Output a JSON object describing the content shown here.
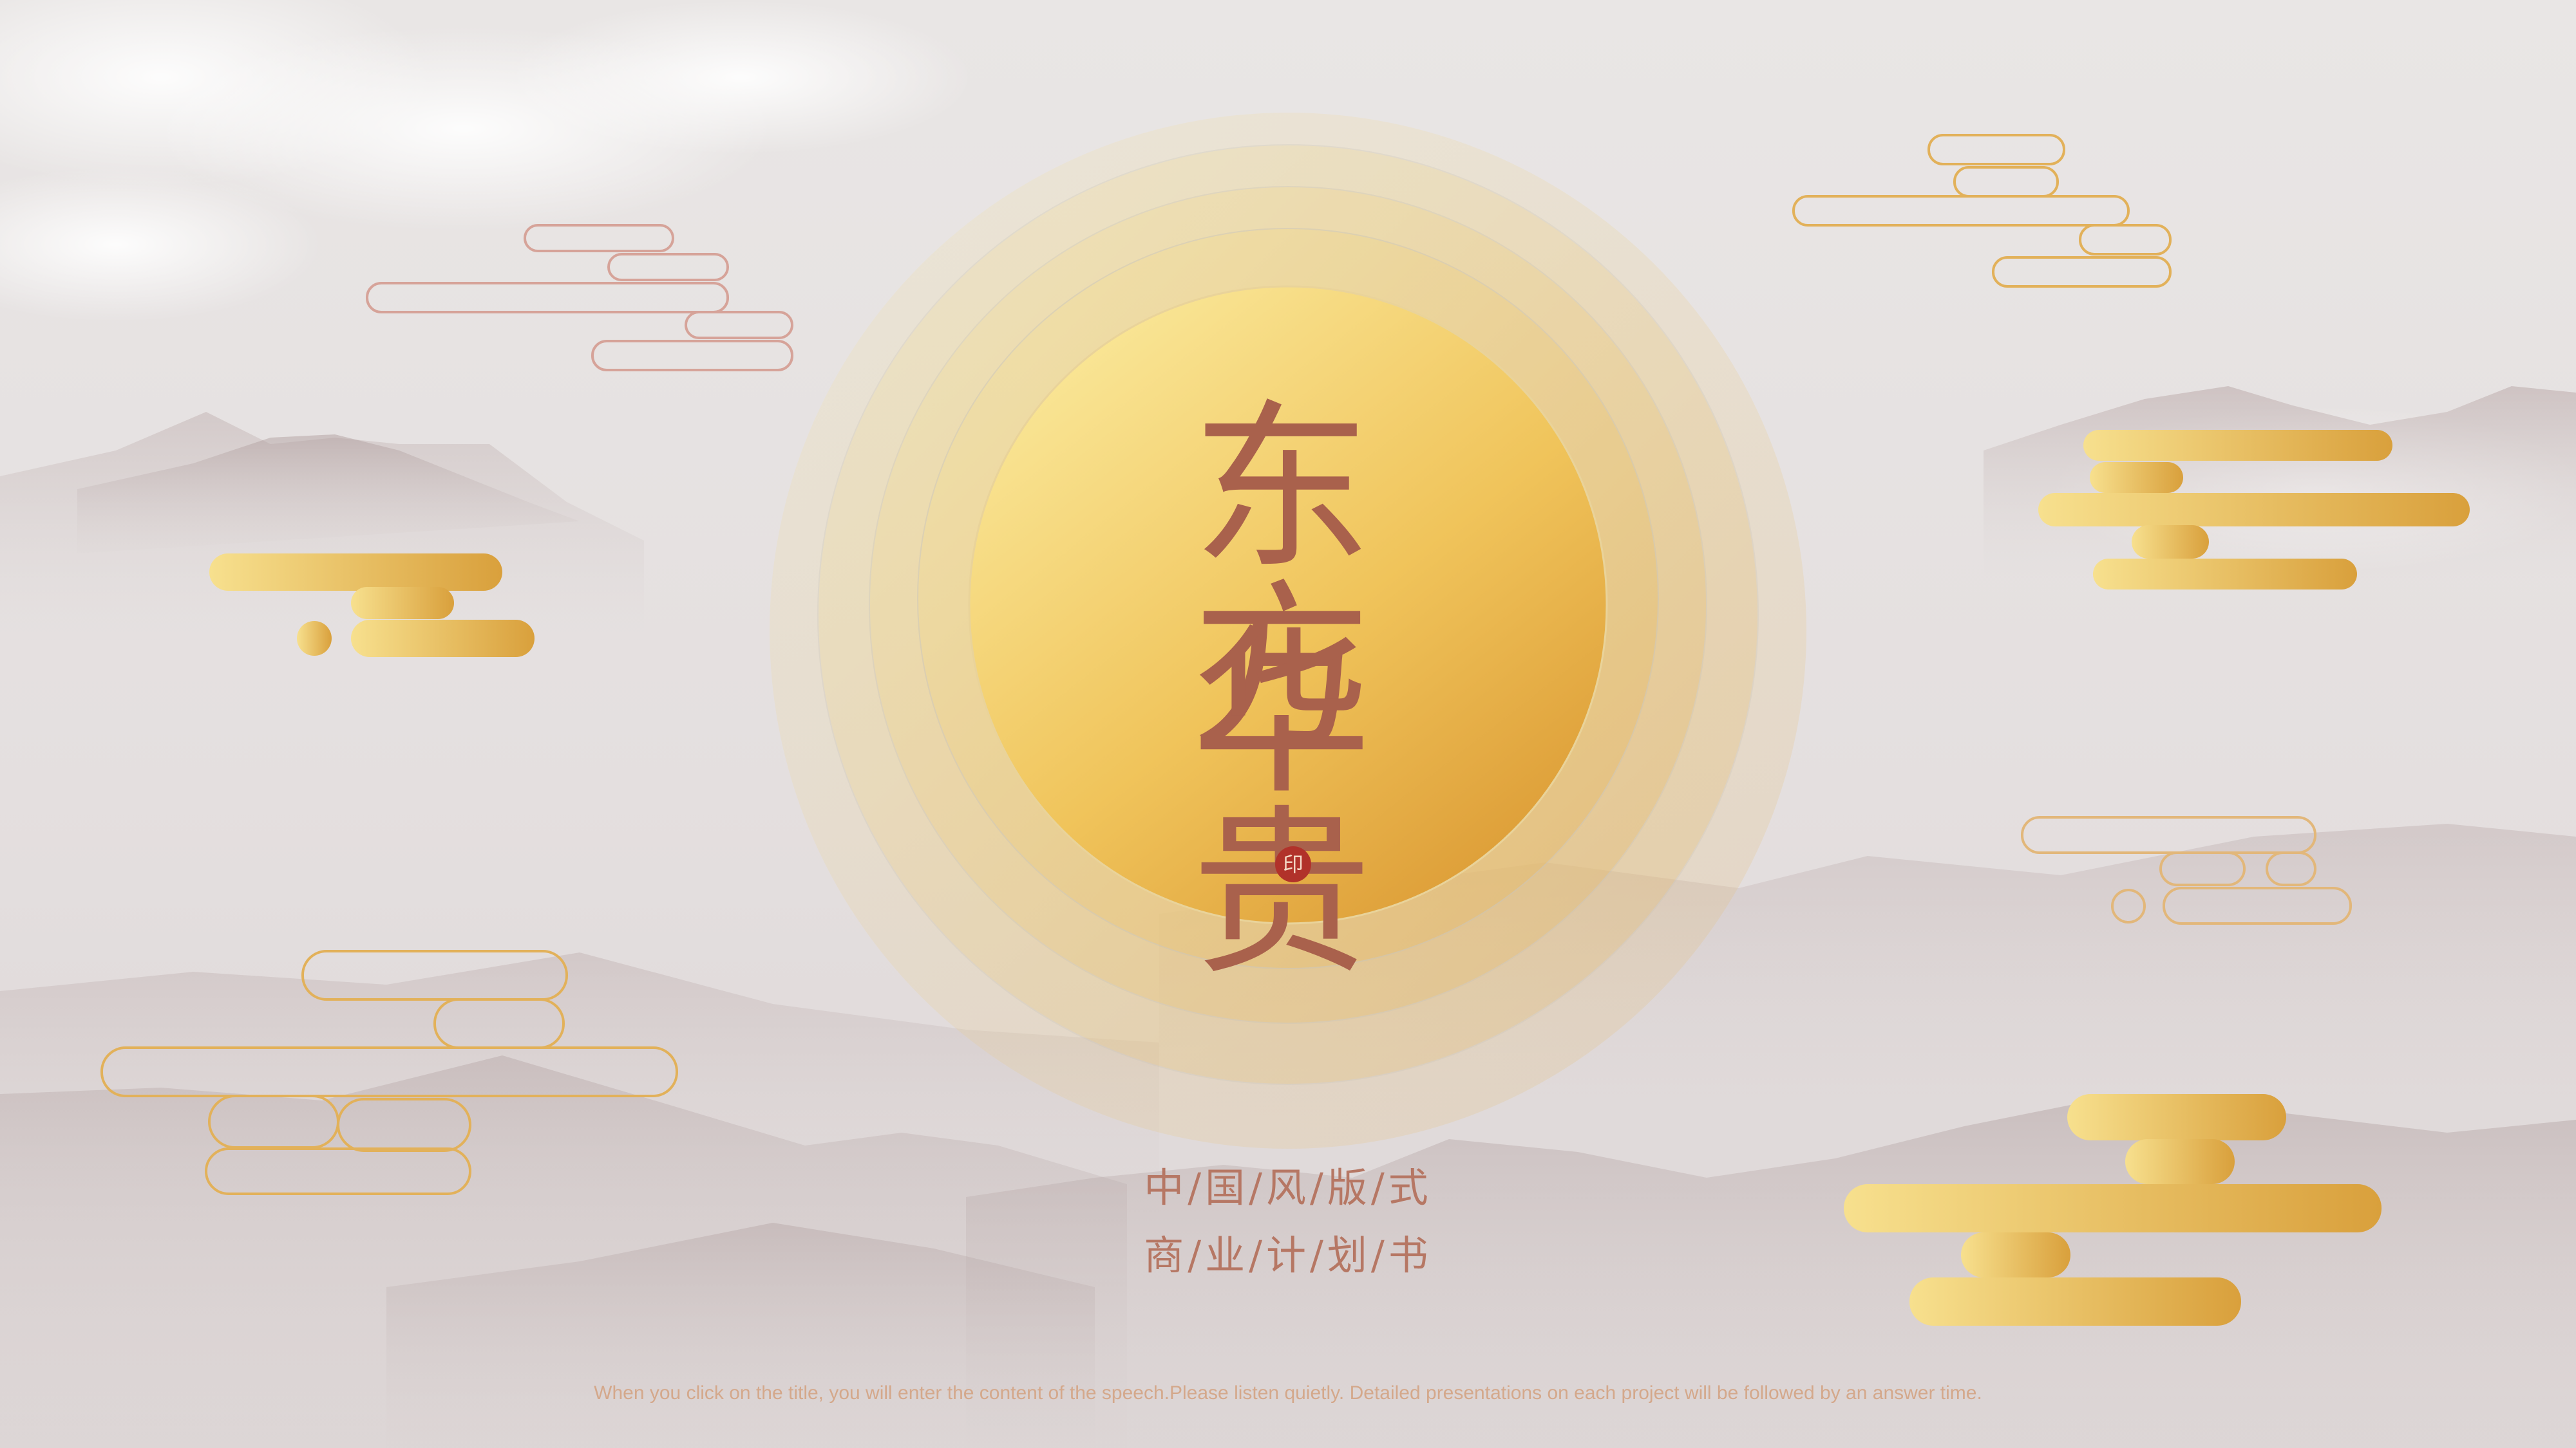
{
  "slide": {
    "title_line_1": "东方",
    "title_line_2": "华贵",
    "subtitle_line_1": "中/国/风/版/式",
    "subtitle_line_2": "商/业/计/划/书",
    "seal_text": "印",
    "footer_note": "When you click on the title, you will enter the content of the speech.Please listen quietly. Detailed presentations on each project will be followed by an answer time."
  },
  "colors": {
    "title": "#a9614c",
    "gold_light": "#f7e08e",
    "gold_dark": "#d9a03c",
    "background": "#e6e2e1",
    "mountain": "#b9a9a9"
  },
  "icons": [
    "sun-disc",
    "cloud-outline",
    "cloud-solid",
    "mountain-range",
    "seal-stamp"
  ]
}
